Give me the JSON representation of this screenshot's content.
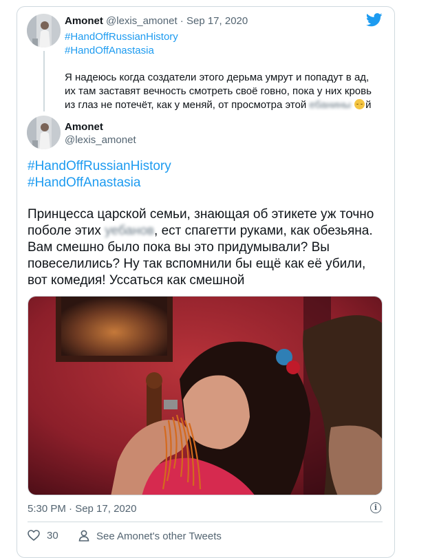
{
  "quoted_tweet": {
    "display_name": "Amonet",
    "handle": "@lexis_amonet",
    "separator": "·",
    "date": "Sep 17, 2020",
    "hashtags": [
      "#HandOffRussianHistory",
      "#HandOffAnastasia"
    ],
    "text_part1": "Я надеюсь когда создатели этого дерьма умрут и попадут в ад, их там заставят вечность смотреть своё говно, пока у них кровь из глаз не потечёт, как у меняй, от просмотра этой ",
    "censored_word": "ебанины",
    "text_part2": "й"
  },
  "main_tweet": {
    "display_name": "Amonet",
    "handle": "@lexis_amonet",
    "hashtags": [
      "#HandOffRussianHistory",
      "#HandOffAnastasia"
    ],
    "text_part1": "Принцесса царской семьи, знающая об этикете уж точно поболе этих ",
    "censored_word": "уебанов",
    "text_part2": ", ест спагетти руками, как обезьяна. Вам смешно было пока вы это придумывали? Вы повеселились? Ну так вспомнили бы ещё как её убили, вот комедия! Уссаться как смешной",
    "photo_icon": "tweet-photo-girl-eating-spaghetti",
    "timestamp": "5:30 PM · Sep 17, 2020"
  },
  "actions": {
    "like_count": "30",
    "see_other_label": "See Amonet's other Tweets"
  },
  "icons": {
    "brand": "twitter-bird-icon",
    "like": "heart-icon",
    "profile": "person-icon",
    "info": "info-icon"
  },
  "colors": {
    "accent": "#1d9bf0",
    "muted": "#536471",
    "border": "#cfd9de"
  }
}
